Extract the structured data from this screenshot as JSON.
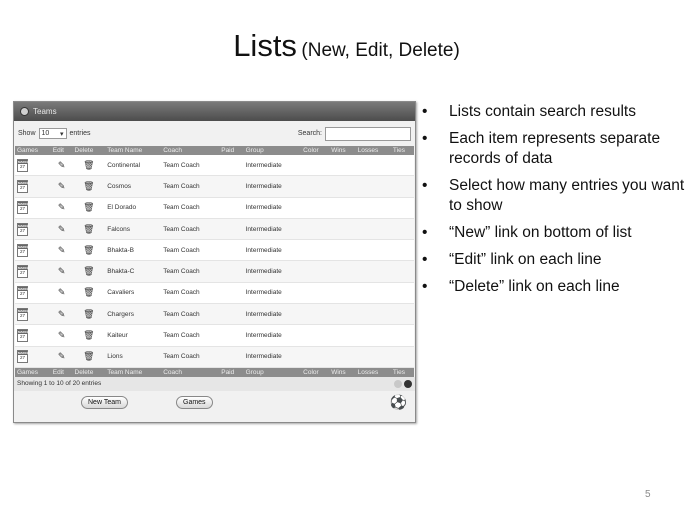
{
  "slide": {
    "title": "Lists",
    "subtitle": "(New, Edit, Delete)",
    "page_number": "5",
    "bullets": [
      "Lists contain search results",
      "Each item represents separate records of data",
      "Select how many entries you want to show",
      "“New” link on bottom of list",
      "“Edit” link on each line",
      "“Delete” link on each line"
    ]
  },
  "panel": {
    "title": "Teams",
    "show_label": "Show",
    "entries_value": "10",
    "entries_label": "entries",
    "search_label": "Search:",
    "search_value": "",
    "columns": [
      "Games",
      "Edit",
      "Delete",
      "Team Name",
      "Coach",
      "Paid",
      "Group",
      "Color",
      "Wins",
      "Losses",
      "Ties"
    ],
    "rows": [
      {
        "team": "Continental",
        "coach": "Team Coach",
        "group": "Intermediate"
      },
      {
        "team": "Cosmos",
        "coach": "Team Coach",
        "group": "Intermediate"
      },
      {
        "team": "El Dorado",
        "coach": "Team Coach",
        "group": "Intermediate"
      },
      {
        "team": "Falcons",
        "coach": "Team Coach",
        "group": "Intermediate"
      },
      {
        "team": "Bhakta-B",
        "coach": "Team Coach",
        "group": "Intermediate"
      },
      {
        "team": "Bhakta-C",
        "coach": "Team Coach",
        "group": "Intermediate"
      },
      {
        "team": "Cavaliers",
        "coach": "Team Coach",
        "group": "Intermediate"
      },
      {
        "team": "Chargers",
        "coach": "Team Coach",
        "group": "Intermediate"
      },
      {
        "team": "Kaiteur",
        "coach": "Team Coach",
        "group": "Intermediate"
      },
      {
        "team": "Lions",
        "coach": "Team Coach",
        "group": "Intermediate"
      }
    ],
    "calendar_day": "27",
    "calendar_month": "MARCH",
    "footer_info": "Showing 1 to 10 of 20 entries",
    "new_button": "New Team",
    "games_button": "Games"
  },
  "icons": {
    "panel": "circle-icon",
    "games": "calendar-icon",
    "edit": "pencil-icon",
    "delete": "trash-icon",
    "prev": "prev-page-icon",
    "next": "next-page-icon",
    "logo": "soccer-logo-icon"
  }
}
